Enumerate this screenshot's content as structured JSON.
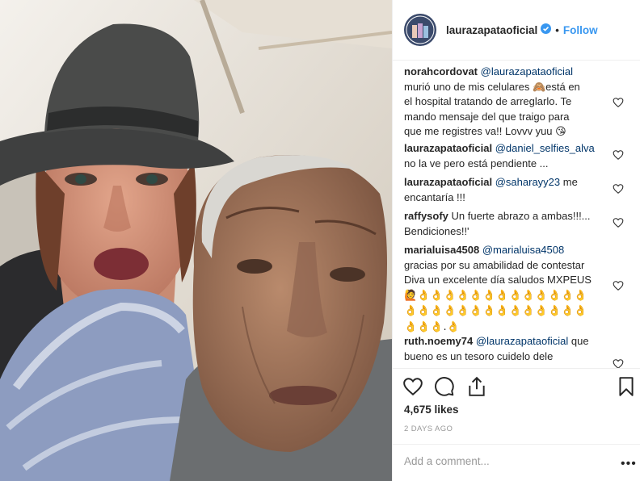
{
  "header": {
    "username": "laurazapataoficial",
    "separator": "•",
    "follow_label": "Follow"
  },
  "comments": [
    {
      "author": "norahcordovat",
      "mention": "@laurazapataoficial",
      "lines": [
        "murió uno de mis celulares 🙈está en",
        "el hospital tratando de arreglarlo. Te",
        "mando mensaje del que traigo para",
        "que me registres va!! Lovvv yuu 😘"
      ]
    },
    {
      "author": "laurazapataoficial",
      "mention": "@daniel_selfies_alva",
      "lines": [
        "no la ve pero está pendiente ..."
      ]
    },
    {
      "author": "laurazapataoficial",
      "mention": "@saharayy23",
      "after_mention": " me",
      "lines": [
        "encantaría !!!"
      ]
    },
    {
      "author": "raffysofy",
      "text": " Un fuerte abrazo a ambas!!!...",
      "lines": [
        "Bendiciones!!'"
      ]
    },
    {
      "author": "marialuisa4508",
      "mention": "@marialuisa4508",
      "lines": [
        "gracias por su amabilidad de contestar",
        "Diva un excelente día saludos MXPEUS",
        "🙋👌👌👌👌👌👌👌👌👌👌👌👌👌",
        "👌👌👌👌👌👌👌👌👌👌👌👌👌👌",
        "👌👌👌.👌"
      ]
    },
    {
      "author": "ruth.noemy74",
      "mention": "@laurazapataoficial",
      "after_mention": " que",
      "lines": [
        "bueno es un tesoro cuidelo dele"
      ]
    }
  ],
  "actions": {
    "like_icon": "heart-icon",
    "comment_icon": "comment-bubble-icon",
    "share_icon": "share-icon",
    "save_icon": "bookmark-icon"
  },
  "likes": "4,675 likes",
  "timestamp": "2 DAYS AGO",
  "add_comment_placeholder": "Add a comment...",
  "more_label": "•••",
  "colors": {
    "link": "#3897f0",
    "mention": "#003569",
    "muted": "#999999",
    "verified": "#3897f0"
  }
}
